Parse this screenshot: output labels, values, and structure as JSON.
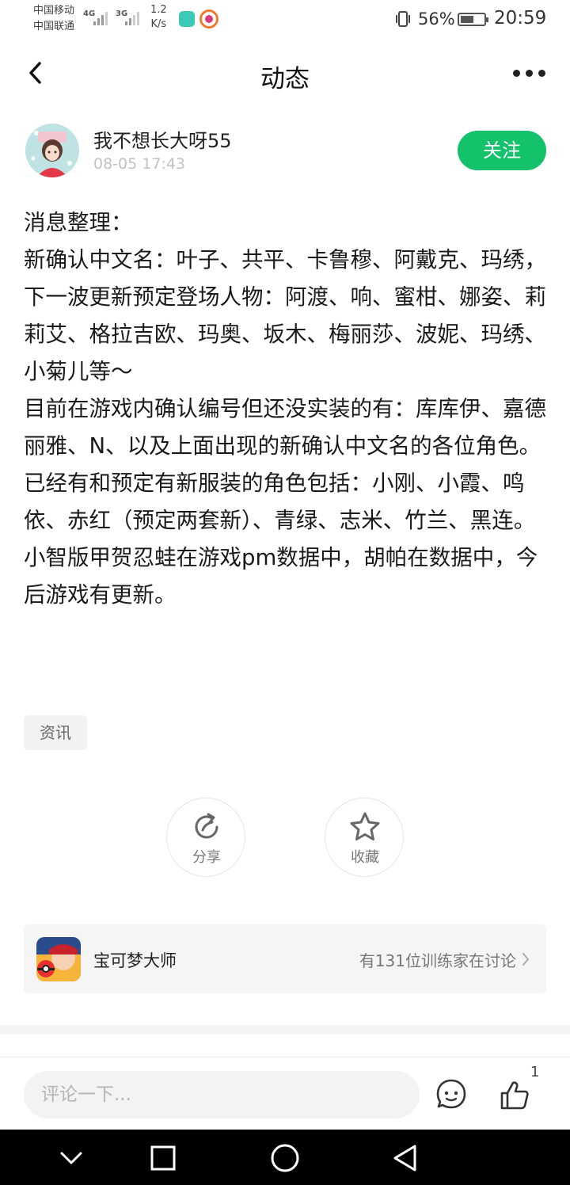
{
  "status_bar": {
    "carrier_1": "中国移动",
    "carrier_2": "中国联通",
    "net_1": "4G",
    "net_2": "3G",
    "speed_value": "1.2",
    "speed_unit": "K/s",
    "battery_percent": "56%",
    "battery_level": 0.56,
    "time": "20:59"
  },
  "header": {
    "title": "动态",
    "back_icon": "chevron-left-icon",
    "more_icon": "more-dots-icon"
  },
  "author": {
    "name": "我不想长大呀55",
    "time": "08-05 17:43",
    "follow_label": "关注"
  },
  "post": {
    "paragraphs": [
      "消息整理：",
      "新确认中文名：叶子、共平、卡鲁穆、阿戴克、玛绣，下一波更新预定登场人物：阿渡、响、蜜柑、娜姿、莉莉艾、格拉吉欧、玛奥、坂木、梅丽莎、波妮、玛绣、小菊儿等～",
      "目前在游戏内确认编号但还没实装的有：库库伊、嘉德丽雅、N、以及上面出现的新确认中文名的各位角色。",
      "已经有和预定有新服装的角色包括：小刚、小霞、鸣依、赤红（预定两套新）、青绿、志米、竹兰、黑连。",
      "小智版甲贺忍蛙在游戏pm数据中，胡帕在数据中，今后游戏有更新。"
    ],
    "tag": "资讯"
  },
  "actions": {
    "share_label": "分享",
    "favorite_label": "收藏"
  },
  "game_card": {
    "name": "宝可梦大师",
    "discussion": "有131位训练家在讨论"
  },
  "comment_bar": {
    "placeholder": "评论一下...",
    "like_count": "1"
  },
  "colors": {
    "accent": "#14c26b",
    "text": "#1a1a1a",
    "muted": "#c2c2c2"
  }
}
